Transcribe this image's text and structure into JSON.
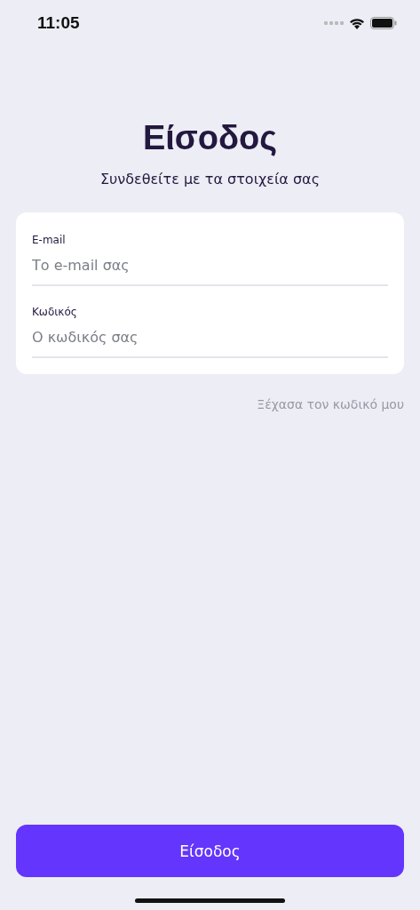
{
  "status_bar": {
    "time": "11:05"
  },
  "title": "Είσοδος",
  "subtitle": "Συνδεθείτε με τα στοιχεία σας",
  "fields": [
    {
      "label": "E-mail",
      "placeholder": "Το e-mail σας"
    },
    {
      "label": "Κωδικός",
      "placeholder": "Ο κωδικός σας"
    }
  ],
  "forgot_link": "Ξέχασα τον κωδικό μου",
  "submit_button": "Είσοδος"
}
